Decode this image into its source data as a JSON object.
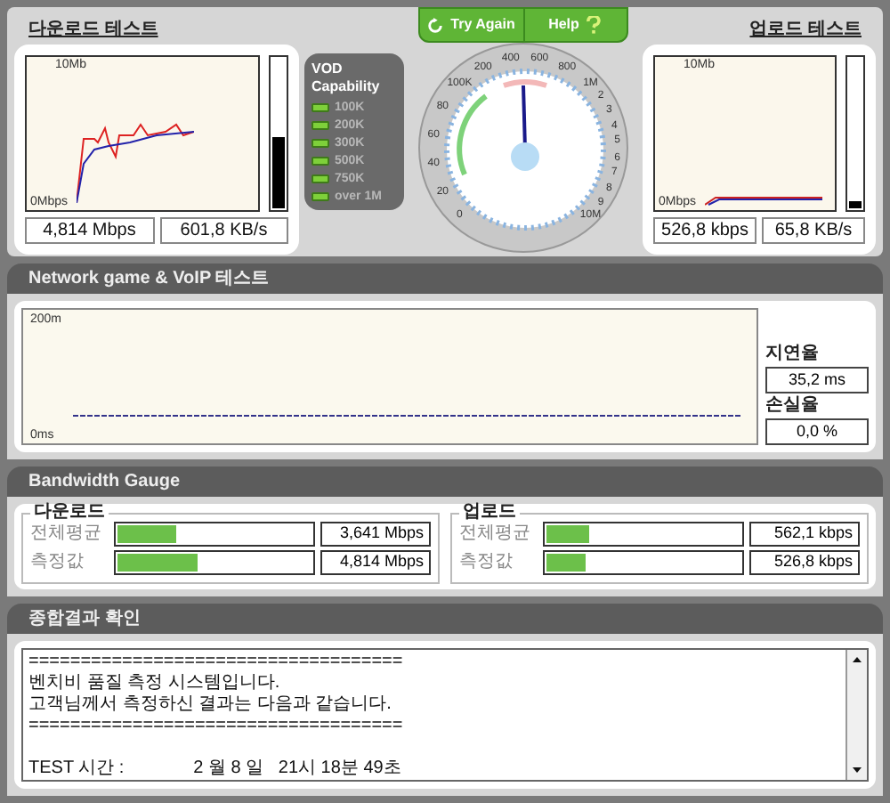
{
  "download_test": {
    "title": "다운로드 테스트",
    "chart": {
      "top_label": "10Mb",
      "bottom_label": "0Mbps"
    },
    "meter": {
      "level": 0.48
    },
    "readouts": [
      "4,814 Mbps",
      "601,8 KB/s"
    ]
  },
  "vod_capability": {
    "title": "VOD Capability",
    "items": [
      {
        "label": "100K",
        "on": true
      },
      {
        "label": "200K",
        "on": true
      },
      {
        "label": "300K",
        "on": true
      },
      {
        "label": "500K",
        "on": true
      },
      {
        "label": "750K",
        "on": true
      },
      {
        "label": "over 1M",
        "on": true
      }
    ]
  },
  "gauge": {
    "buttons": [
      {
        "label": "Try Again",
        "kind": "refresh"
      },
      {
        "label": "Help",
        "kind": "help"
      }
    ],
    "scale_labels": [
      "0",
      "20",
      "40",
      "60",
      "80",
      "100K",
      "200",
      "400",
      "600",
      "800",
      "1M",
      "2",
      "3",
      "4",
      "5",
      "6",
      "7",
      "8",
      "9",
      "10M"
    ]
  },
  "upload_test": {
    "title": "업로드 테스트",
    "chart": {
      "top_label": "10Mb",
      "bottom_label": "0Mbps"
    },
    "meter": {
      "level": 0.05
    },
    "readouts": [
      "526,8 kbps",
      "65,8 KB/s"
    ]
  },
  "network_test": {
    "title": "Network game & VoIP 테스트",
    "chart": {
      "top_label": "200m",
      "bottom_label": "0ms"
    },
    "latency": {
      "label": "지연율",
      "value": "35,2 ms"
    },
    "loss": {
      "label": "손실율",
      "value": "0,0 %"
    }
  },
  "bandwidth_gauge": {
    "title": "Bandwidth Gauge",
    "groups": [
      {
        "title": "다운로드",
        "rows": [
          {
            "label": "전체평균",
            "level": 0.3,
            "value": "3,641 Mbps"
          },
          {
            "label": "측정값",
            "level": 0.41,
            "value": "4,814 Mbps"
          }
        ]
      },
      {
        "title": "업로드",
        "rows": [
          {
            "label": "전체평균",
            "level": 0.22,
            "value": "562,1 kbps"
          },
          {
            "label": "측정값",
            "level": 0.2,
            "value": "526,8 kbps"
          }
        ]
      }
    ]
  },
  "summary": {
    "title": "종합결과 확인",
    "blocks": [
      [
        "====================================",
        "벤치비 품질 측정 시스템입니다.",
        "고객님께서 측정하신 결과는 다음과 같습니다.",
        "===================================="
      ],
      [
        "TEST 시간 :              2 월 8 일   21시 18분 49초"
      ]
    ]
  }
}
